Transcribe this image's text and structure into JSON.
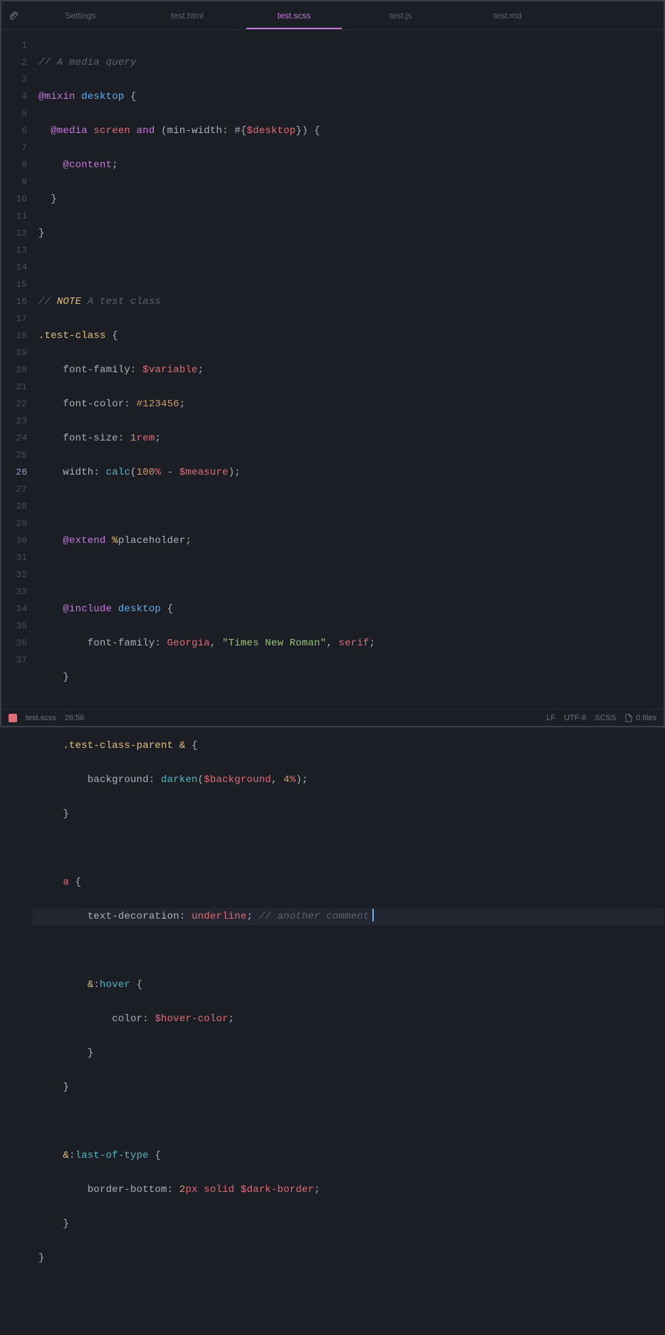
{
  "tabs": [
    {
      "label": "Settings",
      "active": false
    },
    {
      "label": "test.html",
      "active": false
    },
    {
      "label": "test.scss",
      "active": true
    },
    {
      "label": "test.js",
      "active": false
    },
    {
      "label": "test.md",
      "active": false
    }
  ],
  "cursor_line": 26,
  "line_count": 37,
  "code_lines": {
    "l1": "// A media query",
    "l2_mixin": "@mixin",
    "l2_name": "desktop",
    "l2_brace": "{",
    "l3_media": "@media",
    "l3_screen": "screen",
    "l3_and": "and",
    "l3_open": "(",
    "l3_prop": "min-width",
    "l3_colon": ":",
    "l3_hash": "#{",
    "l3_var": "$desktop",
    "l3_close": "})",
    "l3_brace": "{",
    "l4_content": "@content",
    "l4_semi": ";",
    "l5": "}",
    "l6": "}",
    "l8_slash": "// ",
    "l8_note": "NOTE",
    "l8_rest": " A test class",
    "l9_class": ".test-class",
    "l9_brace": "{",
    "l10_prop": "font-family",
    "l10_colon": ":",
    "l10_var": "$variable",
    "l10_semi": ";",
    "l11_prop": "font-color",
    "l11_colon": ":",
    "l11_hex": "#123456",
    "l11_semi": ";",
    "l12_prop": "font-size",
    "l12_colon": ":",
    "l12_num": "1",
    "l12_unit": "rem",
    "l12_semi": ";",
    "l13_prop": "width",
    "l13_colon": ":",
    "l13_func": "calc",
    "l13_open": "(",
    "l13_num": "100",
    "l13_pct": "%",
    "l13_minus": " - ",
    "l13_var": "$measure",
    "l13_close": ")",
    "l13_semi": ";",
    "l15_extend": "@extend",
    "l15_pct": "%",
    "l15_ph": "placeholder",
    "l15_semi": ";",
    "l17_include": "@include",
    "l17_name": "desktop",
    "l17_brace": "{",
    "l18_prop": "font-family",
    "l18_colon": ":",
    "l18_v1": "Georgia",
    "l18_c1": ",",
    "l18_v2": "\"Times New Roman\"",
    "l18_c2": ",",
    "l18_v3": "serif",
    "l18_semi": ";",
    "l19": "}",
    "l21_sel": ".test-class-parent",
    "l21_amp": "&",
    "l21_brace": "{",
    "l22_prop": "background",
    "l22_colon": ":",
    "l22_func": "darken",
    "l22_open": "(",
    "l22_var": "$background",
    "l22_comma": ",",
    "l22_num": "4",
    "l22_pct": "%",
    "l22_close": ")",
    "l22_semi": ";",
    "l23": "}",
    "l25_sel": "a",
    "l25_brace": "{",
    "l26_prop": "text-decoration",
    "l26_colon": ":",
    "l26_val": "underline",
    "l26_semi": ";",
    "l26_comment": "// another comment",
    "l28_amp": "&",
    "l28_colon": ":",
    "l28_pseudo": "hover",
    "l28_brace": "{",
    "l29_prop": "color",
    "l29_colon": ":",
    "l29_var": "$hover-color",
    "l29_semi": ";",
    "l30": "}",
    "l31": "}",
    "l33_amp": "&",
    "l33_colon": ":",
    "l33_pseudo": "last-of-type",
    "l33_brace": "{",
    "l34_prop": "border-bottom",
    "l34_colon": ":",
    "l34_num": "2",
    "l34_unit": "px",
    "l34_val": "solid",
    "l34_var": "$dark-border",
    "l34_semi": ";",
    "l35": "}",
    "l36": "}"
  },
  "statusbar": {
    "filename": "test.scss",
    "position": "26:56",
    "line_ending": "LF",
    "encoding": "UTF-8",
    "language": "SCSS",
    "files": "0 files"
  }
}
